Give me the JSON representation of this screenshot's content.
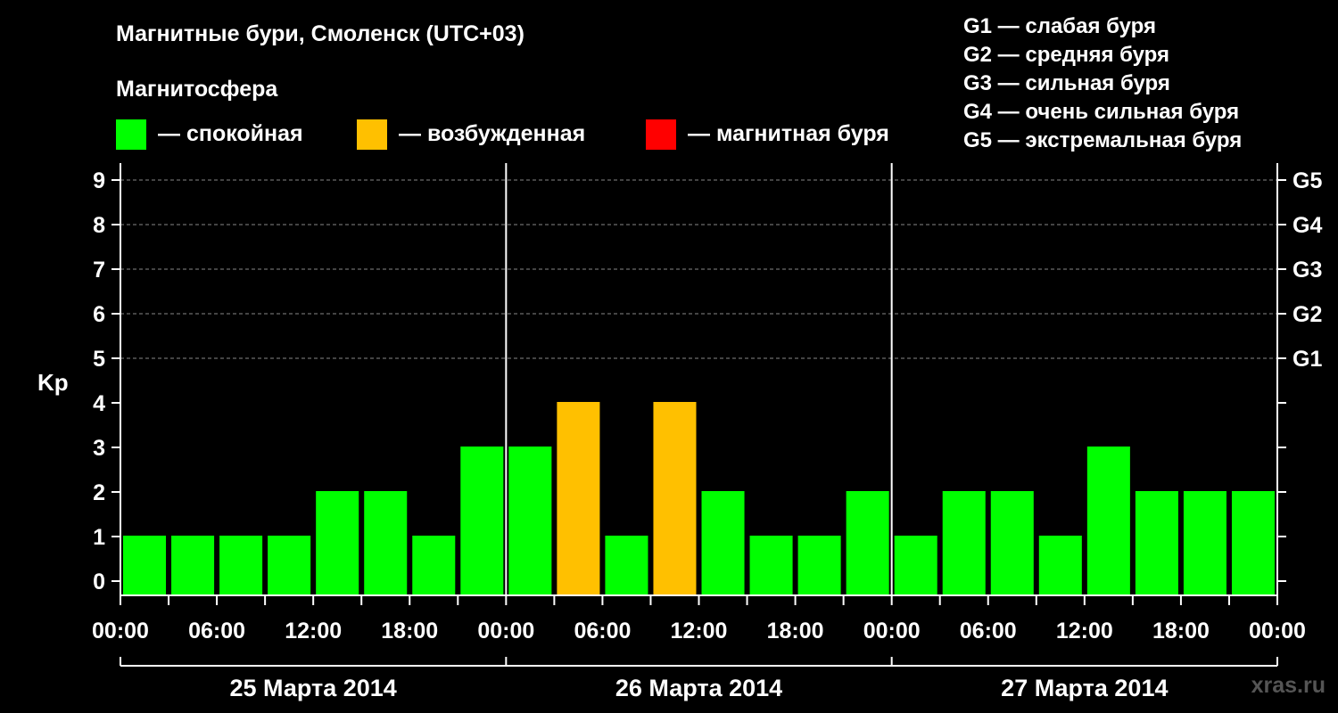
{
  "title": "Магнитные бури, Смоленск (UTC+03)",
  "subtitle": "Магнитосфера",
  "legend": [
    {
      "label": "— спокойная",
      "color": "#00ff00"
    },
    {
      "label": "— возбужденная",
      "color": "#ffc000"
    },
    {
      "label": "— магнитная буря",
      "color": "#ff0000"
    }
  ],
  "g_scale": [
    {
      "label": "G1 — слабая буря"
    },
    {
      "label": "G2 — средняя буря"
    },
    {
      "label": "G3 — сильная буря"
    },
    {
      "label": "G4 — очень сильная буря"
    },
    {
      "label": "G5 — экстремальная буря"
    }
  ],
  "watermark": "xras.ru",
  "colors": {
    "calm": "#00ff00",
    "excited": "#ffc000",
    "storm": "#ff0000",
    "background": "#000000",
    "axis": "#ffffff",
    "grid": "#888888"
  },
  "chart_data": {
    "type": "bar",
    "ylabel": "Kp",
    "ylim": [
      0,
      9
    ],
    "y_ticks": [
      "0",
      "1",
      "2",
      "3",
      "4",
      "5",
      "6",
      "7",
      "8",
      "9"
    ],
    "right_ticks": [
      {
        "value": 5,
        "label": "G1"
      },
      {
        "value": 6,
        "label": "G2"
      },
      {
        "value": 7,
        "label": "G3"
      },
      {
        "value": 8,
        "label": "G4"
      },
      {
        "value": 9,
        "label": "G5"
      }
    ],
    "grid": "dashed horizontal lines at Kp 5–9",
    "x_tick_labels": [
      "00:00",
      "06:00",
      "12:00",
      "18:00",
      "00:00",
      "06:00",
      "12:00",
      "18:00",
      "00:00",
      "06:00",
      "12:00",
      "18:00",
      "00:00"
    ],
    "days": [
      "25 Марта 2014",
      "26 Марта 2014",
      "27 Марта 2014"
    ],
    "interval_hours": 3,
    "values": [
      1,
      1,
      1,
      1,
      2,
      2,
      1,
      3,
      3,
      4,
      1,
      4,
      2,
      1,
      1,
      2,
      1,
      2,
      2,
      1,
      3,
      2,
      2,
      2
    ],
    "levels": [
      "calm",
      "calm",
      "calm",
      "calm",
      "calm",
      "calm",
      "calm",
      "calm",
      "calm",
      "excited",
      "calm",
      "excited",
      "calm",
      "calm",
      "calm",
      "calm",
      "calm",
      "calm",
      "calm",
      "calm",
      "calm",
      "calm",
      "calm",
      "calm"
    ]
  }
}
